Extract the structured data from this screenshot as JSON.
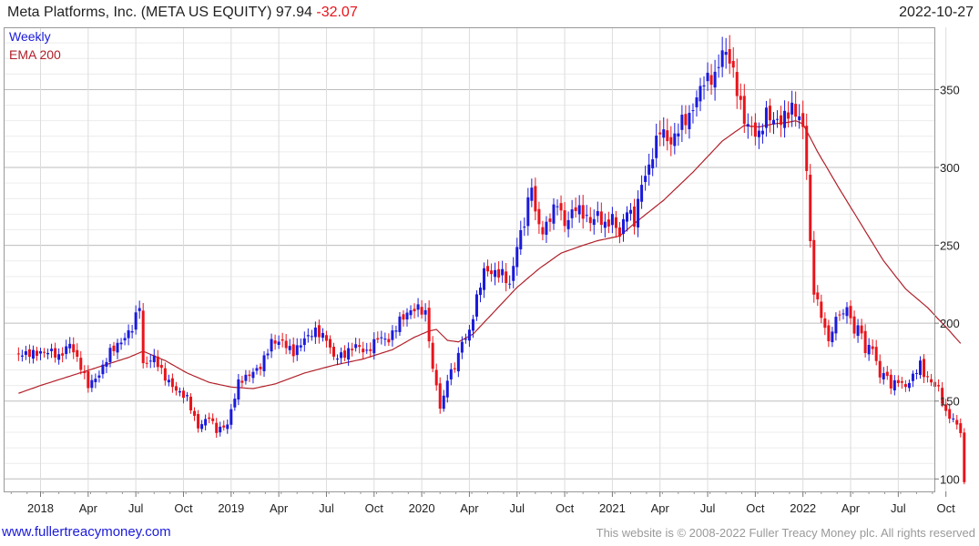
{
  "header": {
    "title": "Meta Platforms, Inc.  (META US EQUITY) 97.94",
    "change": "-32.07",
    "date": "2022-10-27"
  },
  "footer": {
    "link": "www.fullertreacymoney.com",
    "copyright": "This website is © 2008-2022 Fuller Treacy Money plc. All rights reserved"
  },
  "colors": {
    "up": "#1a1adb",
    "down": "#e8141b",
    "ema": "#b0202a",
    "grid": "#d8d8d8"
  },
  "chart_data": {
    "type": "candlestick",
    "legend": [
      "Weekly",
      "EMA 200"
    ],
    "y_ticks": [
      100,
      150,
      200,
      250,
      300,
      350
    ],
    "ylim": [
      92,
      390
    ],
    "x_ticks": [
      {
        "label": "2018",
        "week": 0
      },
      {
        "label": "Apr",
        "week": 13
      },
      {
        "label": "Jul",
        "week": 26
      },
      {
        "label": "Oct",
        "week": 39
      },
      {
        "label": "2019",
        "week": 52
      },
      {
        "label": "Apr",
        "week": 65
      },
      {
        "label": "Jul",
        "week": 78
      },
      {
        "label": "Oct",
        "week": 91
      },
      {
        "label": "2020",
        "week": 104
      },
      {
        "label": "Apr",
        "week": 117
      },
      {
        "label": "Jul",
        "week": 130
      },
      {
        "label": "Oct",
        "week": 143
      },
      {
        "label": "2021",
        "week": 156
      },
      {
        "label": "Apr",
        "week": 169
      },
      {
        "label": "Jul",
        "week": 182
      },
      {
        "label": "Oct",
        "week": 195
      },
      {
        "label": "2022",
        "week": 208
      },
      {
        "label": "Apr",
        "week": 221
      },
      {
        "label": "Jul",
        "week": 234
      },
      {
        "label": "Oct",
        "week": 247
      }
    ],
    "close_anchors": [
      [
        -6,
        180
      ],
      [
        0,
        181
      ],
      [
        3,
        182
      ],
      [
        5,
        178
      ],
      [
        8,
        187
      ],
      [
        11,
        172
      ],
      [
        13,
        160
      ],
      [
        16,
        167
      ],
      [
        19,
        182
      ],
      [
        22,
        188
      ],
      [
        25,
        197
      ],
      [
        27,
        212
      ],
      [
        28,
        173
      ],
      [
        31,
        178
      ],
      [
        34,
        165
      ],
      [
        37,
        157
      ],
      [
        40,
        152
      ],
      [
        43,
        133
      ],
      [
        46,
        140
      ],
      [
        48,
        131
      ],
      [
        51,
        135
      ],
      [
        54,
        162
      ],
      [
        57,
        167
      ],
      [
        60,
        172
      ],
      [
        63,
        188
      ],
      [
        66,
        188
      ],
      [
        69,
        181
      ],
      [
        72,
        190
      ],
      [
        75,
        195
      ],
      [
        78,
        190
      ],
      [
        80,
        178
      ],
      [
        83,
        180
      ],
      [
        86,
        186
      ],
      [
        89,
        181
      ],
      [
        92,
        191
      ],
      [
        95,
        189
      ],
      [
        98,
        202
      ],
      [
        101,
        208
      ],
      [
        103,
        210
      ],
      [
        105,
        206
      ],
      [
        106,
        190
      ],
      [
        107,
        170
      ],
      [
        108,
        160
      ],
      [
        109,
        146
      ],
      [
        110,
        152
      ],
      [
        111,
        165
      ],
      [
        113,
        172
      ],
      [
        115,
        188
      ],
      [
        117,
        194
      ],
      [
        119,
        216
      ],
      [
        121,
        234
      ],
      [
        124,
        232
      ],
      [
        126,
        232
      ],
      [
        128,
        224
      ],
      [
        130,
        250
      ],
      [
        132,
        265
      ],
      [
        134,
        290
      ],
      [
        135,
        270
      ],
      [
        137,
        258
      ],
      [
        139,
        268
      ],
      [
        141,
        278
      ],
      [
        143,
        263
      ],
      [
        146,
        275
      ],
      [
        148,
        270
      ],
      [
        150,
        265
      ],
      [
        152,
        270
      ],
      [
        154,
        262
      ],
      [
        156,
        268
      ],
      [
        158,
        256
      ],
      [
        160,
        274
      ],
      [
        162,
        265
      ],
      [
        164,
        290
      ],
      [
        166,
        300
      ],
      [
        169,
        325
      ],
      [
        172,
        315
      ],
      [
        175,
        330
      ],
      [
        177,
        332
      ],
      [
        179,
        345
      ],
      [
        181,
        356
      ],
      [
        184,
        358
      ],
      [
        186,
        375
      ],
      [
        188,
        370
      ],
      [
        190,
        350
      ],
      [
        192,
        330
      ],
      [
        194,
        325
      ],
      [
        196,
        320
      ],
      [
        198,
        335
      ],
      [
        200,
        330
      ],
      [
        202,
        330
      ],
      [
        205,
        338
      ],
      [
        207,
        332
      ],
      [
        208,
        325
      ],
      [
        209,
        300
      ],
      [
        210,
        250
      ],
      [
        211,
        221
      ],
      [
        213,
        205
      ],
      [
        215,
        188
      ],
      [
        216,
        196
      ],
      [
        218,
        208
      ],
      [
        219,
        204
      ],
      [
        220,
        212
      ],
      [
        222,
        193
      ],
      [
        223,
        200
      ],
      [
        225,
        183
      ],
      [
        227,
        185
      ],
      [
        229,
        165
      ],
      [
        230,
        169
      ],
      [
        232,
        160
      ],
      [
        234,
        163
      ],
      [
        236,
        159
      ],
      [
        238,
        166
      ],
      [
        240,
        174
      ],
      [
        241,
        167
      ],
      [
        243,
        162
      ],
      [
        245,
        158
      ],
      [
        246,
        150
      ],
      [
        247,
        142
      ],
      [
        249,
        138
      ],
      [
        250,
        135
      ],
      [
        251,
        130
      ],
      [
        252,
        97.94
      ]
    ],
    "ema_anchors": [
      [
        -6,
        155
      ],
      [
        0,
        160
      ],
      [
        8,
        166
      ],
      [
        16,
        172
      ],
      [
        24,
        178
      ],
      [
        28,
        182
      ],
      [
        34,
        176
      ],
      [
        40,
        168
      ],
      [
        46,
        162
      ],
      [
        52,
        159
      ],
      [
        58,
        158
      ],
      [
        64,
        161
      ],
      [
        72,
        168
      ],
      [
        80,
        173
      ],
      [
        88,
        177
      ],
      [
        96,
        183
      ],
      [
        102,
        191
      ],
      [
        106,
        195
      ],
      [
        108,
        196
      ],
      [
        111,
        189
      ],
      [
        114,
        188
      ],
      [
        118,
        193
      ],
      [
        124,
        208
      ],
      [
        130,
        223
      ],
      [
        136,
        235
      ],
      [
        142,
        245
      ],
      [
        148,
        250
      ],
      [
        152,
        253
      ],
      [
        158,
        256
      ],
      [
        162,
        264
      ],
      [
        170,
        279
      ],
      [
        178,
        297
      ],
      [
        186,
        317
      ],
      [
        192,
        327
      ],
      [
        196,
        326
      ],
      [
        200,
        328
      ],
      [
        204,
        329
      ],
      [
        206,
        330
      ],
      [
        208,
        328
      ],
      [
        212,
        310
      ],
      [
        218,
        286
      ],
      [
        224,
        263
      ],
      [
        230,
        240
      ],
      [
        236,
        222
      ],
      [
        242,
        210
      ],
      [
        248,
        195
      ],
      [
        251,
        187
      ]
    ]
  }
}
